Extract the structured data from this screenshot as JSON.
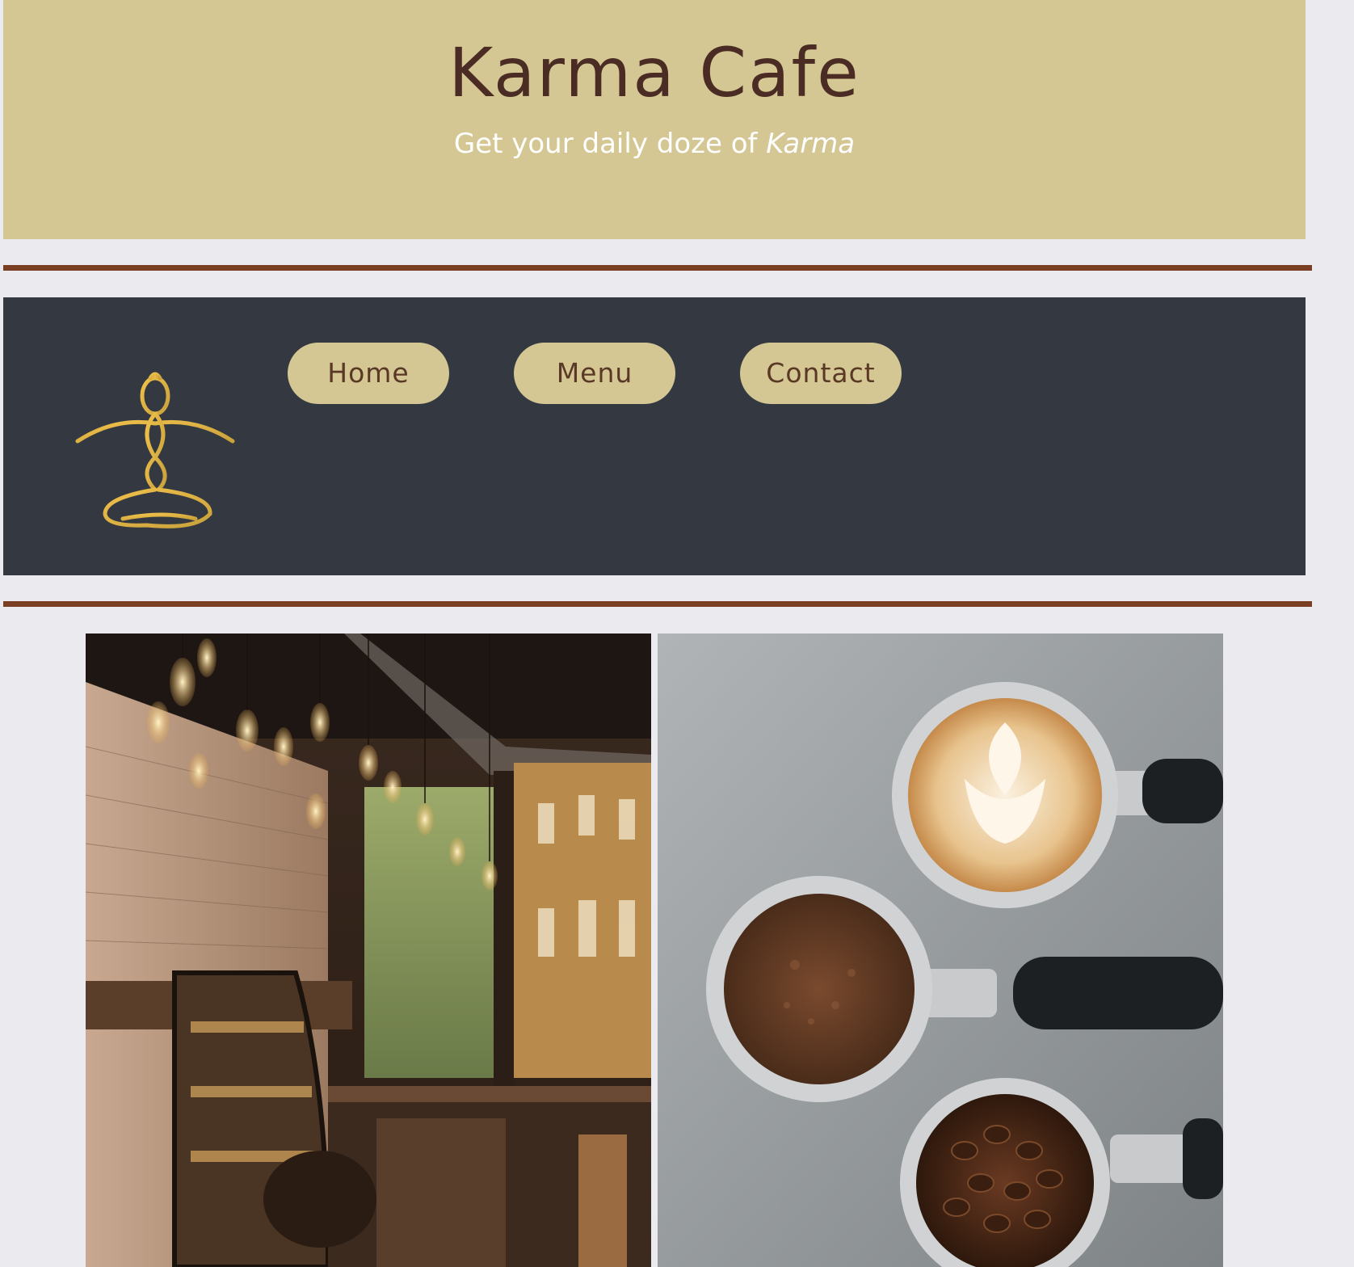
{
  "header": {
    "title": "Karma Cafe",
    "tagline_prefix": "Get your daily doze of ",
    "tagline_emphasis": "Karma"
  },
  "nav": {
    "logo_icon": "meditation-figure-logo",
    "items": [
      {
        "label": "Home"
      },
      {
        "label": "Menu"
      },
      {
        "label": "Contact"
      }
    ]
  },
  "gallery": {
    "images": [
      {
        "name": "cafe-interior-photo"
      },
      {
        "name": "espresso-portafilters-photo"
      }
    ]
  },
  "colors": {
    "page_background": "#ebebef",
    "header_background": "#d4c793",
    "title_text": "#4a2c24",
    "divider": "#7a3e22",
    "nav_background": "#343840",
    "button_background": "#d4c793",
    "button_text": "#5a3826",
    "logo_gold": "#e0b84a"
  }
}
